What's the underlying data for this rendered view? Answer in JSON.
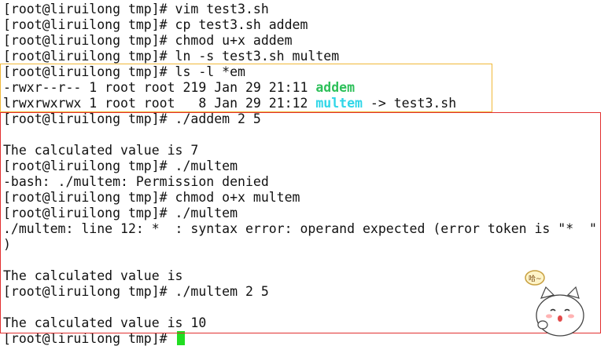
{
  "terminal": {
    "lines": [
      {
        "text": "[root@liruilong tmp]# vim test3.sh"
      },
      {
        "text": "[root@liruilong tmp]# cp test3.sh addem"
      },
      {
        "text": "[root@liruilong tmp]# chmod u+x addem"
      },
      {
        "text": "[root@liruilong tmp]# ln -s test3.sh multem"
      },
      {
        "text": "[root@liruilong tmp]# ls -l *em"
      },
      {
        "prefix": "-rwxr--r-- 1 root root 219 Jan 29 21:11 ",
        "name": "addem",
        "suffix": ""
      },
      {
        "prefix": "lrwxrwxrwx 1 root root   8 Jan 29 21:12 ",
        "name": "multem",
        "suffix": " -> test3.sh"
      },
      {
        "text": "[root@liruilong tmp]# ./addem 2 5"
      },
      {
        "text": ""
      },
      {
        "text": "The calculated value is 7"
      },
      {
        "text": "[root@liruilong tmp]# ./multem"
      },
      {
        "text": "-bash: ./multem: Permission denied"
      },
      {
        "text": "[root@liruilong tmp]# chmod o+x multem"
      },
      {
        "text": "[root@liruilong tmp]# ./multem"
      },
      {
        "text": "./multem: line 12: *  : syntax error: operand expected (error token is \"*  \""
      },
      {
        "text": ")"
      },
      {
        "text": ""
      },
      {
        "text": "The calculated value is"
      },
      {
        "text": "[root@liruilong tmp]# ./multem 2 5"
      },
      {
        "text": ""
      },
      {
        "text": "The calculated value is 10"
      },
      {
        "text": "[root@liruilong tmp]# "
      }
    ]
  },
  "colors": {
    "executable": "#2ec05a",
    "symlink": "#30d6e8",
    "cursor": "#22dd22",
    "highlight_yellow": "#f0b838",
    "highlight_red": "#e23030"
  },
  "sticker": {
    "icon": "cat-sticker-icon"
  }
}
